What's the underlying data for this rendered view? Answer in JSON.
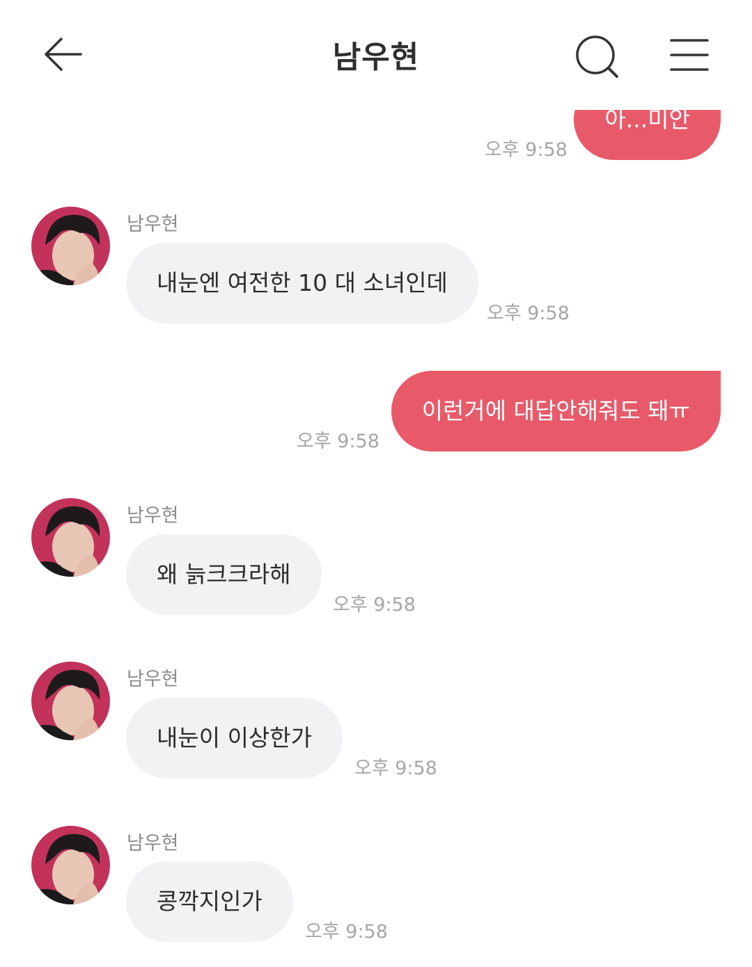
{
  "header": {
    "title": "남우현",
    "back_icon": "back-arrow-icon",
    "search_icon": "search-icon",
    "menu_icon": "menu-icon"
  },
  "colors": {
    "outgoing_bubble": "#e85a6a",
    "incoming_bubble": "#f2f2f5",
    "timestamp": "#a6a6a6"
  },
  "messages": [
    {
      "direction": "out",
      "text": "아...미안",
      "time": "오후 9:58"
    },
    {
      "direction": "in",
      "sender": "남우현",
      "text": "내눈엔 여전한 10 대 소녀인데",
      "time": "오후 9:58"
    },
    {
      "direction": "out",
      "text": "이런거에 대답안해줘도 돼ㅠ",
      "time": "오후 9:58"
    },
    {
      "direction": "in",
      "sender": "남우현",
      "text": "왜 늙크크라해",
      "time": "오후 9:58"
    },
    {
      "direction": "in",
      "sender": "남우현",
      "text": "내눈이 이상한가",
      "time": "오후 9:58"
    },
    {
      "direction": "in",
      "sender": "남우현",
      "text": "콩깍지인가",
      "time": "오후 9:58"
    }
  ]
}
